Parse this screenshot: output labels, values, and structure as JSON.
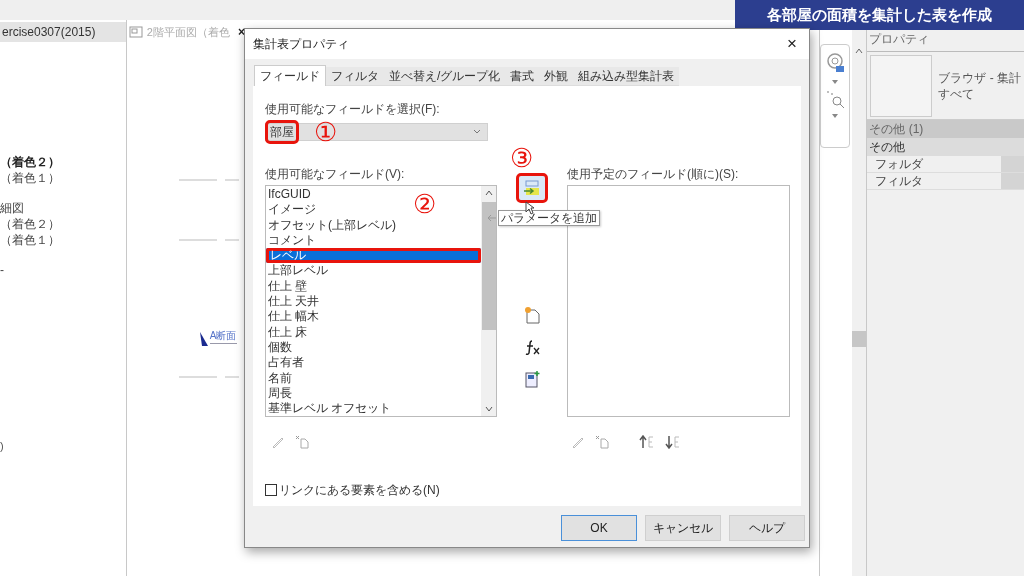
{
  "banner": {
    "title": "各部屋の面積を集計した表を作成"
  },
  "project_browser": {
    "tab": "ercise0307(2015)",
    "items": [
      {
        "label": "（着色２）",
        "bold": true
      },
      {
        "label": "（着色１）",
        "bold": false
      },
      {
        "label": "細図",
        "bold": false
      },
      {
        "label": "（着色２）",
        "bold": false
      },
      {
        "label": "（着色１）",
        "bold": false
      },
      {
        "label": "-",
        "bold": false
      }
    ],
    "footer": ")"
  },
  "view": {
    "tab": "2階平面図（着色",
    "close": "×",
    "section_label": "A断面"
  },
  "properties": {
    "title": "プロパティ",
    "type_lines": [
      "ブラウザ - 集計",
      "すべて"
    ],
    "group_header": "その他 (1)",
    "section": "その他",
    "rows": [
      {
        "label": "フォルダ"
      },
      {
        "label": "フィルタ"
      }
    ]
  },
  "dialog": {
    "title": "集計表プロパティ",
    "close": "×",
    "tabs": [
      {
        "label": "フィールド",
        "selected": true
      },
      {
        "label": "フィルタ",
        "selected": false
      },
      {
        "label": "並べ替え/グループ化",
        "selected": false
      },
      {
        "label": "書式",
        "selected": false
      },
      {
        "label": "外観",
        "selected": false
      },
      {
        "label": "組み込み型集計表",
        "selected": false
      }
    ],
    "category_label": "使用可能なフィールドを選択(F):",
    "category_select": {
      "value": "部屋",
      "highlighted": true,
      "step": "①"
    },
    "available_label": "使用可能なフィールド(V):",
    "available_step": "②",
    "available_fields": [
      {
        "label": "IfcGUID",
        "selected": false,
        "highlighted": false
      },
      {
        "label": "イメージ",
        "selected": false,
        "highlighted": false
      },
      {
        "label": "オフセット(上部レベル)",
        "selected": false,
        "highlighted": false
      },
      {
        "label": "コメント",
        "selected": false,
        "highlighted": false
      },
      {
        "label": "レベル",
        "selected": true,
        "highlighted": true
      },
      {
        "label": "上部レベル",
        "selected": false,
        "highlighted": false
      },
      {
        "label": "仕上 壁",
        "selected": false,
        "highlighted": false
      },
      {
        "label": "仕上 天井",
        "selected": false,
        "highlighted": false
      },
      {
        "label": "仕上 幅木",
        "selected": false,
        "highlighted": false
      },
      {
        "label": "仕上 床",
        "selected": false,
        "highlighted": false
      },
      {
        "label": "個数",
        "selected": false,
        "highlighted": false
      },
      {
        "label": "占有者",
        "selected": false,
        "highlighted": false
      },
      {
        "label": "名前",
        "selected": false,
        "highlighted": false
      },
      {
        "label": "周長",
        "selected": false,
        "highlighted": false
      },
      {
        "label": "基準レベル オフセット",
        "selected": false,
        "highlighted": false
      }
    ],
    "add_button": {
      "highlighted": true,
      "step": "③",
      "tooltip": "パラメータを追加"
    },
    "scheduled_label": "使用予定のフィールド(順に)(S):",
    "include_links": {
      "label": "リンクにある要素を含める(N)",
      "checked": false
    },
    "buttons": [
      {
        "label": "OK",
        "default": true
      },
      {
        "label": "キャンセル",
        "default": false
      },
      {
        "label": "ヘルプ",
        "default": false
      }
    ]
  }
}
